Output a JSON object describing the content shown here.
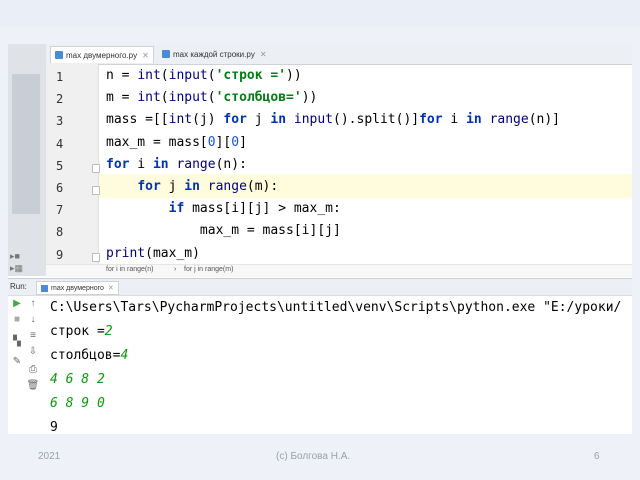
{
  "editor": {
    "tabs": [
      {
        "label": "max двумерного.py",
        "active": true
      },
      {
        "label": "max каждой строки.py",
        "active": false
      }
    ],
    "line_numbers": [
      "1",
      "2",
      "3",
      "4",
      "5",
      "6",
      "7",
      "8",
      "9"
    ],
    "code_lines": [
      [
        {
          "t": "n = ",
          "c": ""
        },
        {
          "t": "int",
          "c": "bi"
        },
        {
          "t": "(",
          "c": ""
        },
        {
          "t": "input",
          "c": "bi"
        },
        {
          "t": "(",
          "c": ""
        },
        {
          "t": "'строк ='",
          "c": "st"
        },
        {
          "t": "))",
          "c": ""
        }
      ],
      [
        {
          "t": "m = ",
          "c": ""
        },
        {
          "t": "int",
          "c": "bi"
        },
        {
          "t": "(",
          "c": ""
        },
        {
          "t": "input",
          "c": "bi"
        },
        {
          "t": "(",
          "c": ""
        },
        {
          "t": "'столбцов='",
          "c": "st"
        },
        {
          "t": "))",
          "c": ""
        }
      ],
      [
        {
          "t": "mass =[[",
          "c": ""
        },
        {
          "t": "int",
          "c": "bi"
        },
        {
          "t": "(j) ",
          "c": ""
        },
        {
          "t": "for",
          "c": "kw"
        },
        {
          "t": " j ",
          "c": ""
        },
        {
          "t": "in",
          "c": "kw"
        },
        {
          "t": " ",
          "c": ""
        },
        {
          "t": "input",
          "c": "bi"
        },
        {
          "t": "().split()]",
          "c": ""
        },
        {
          "t": "for",
          "c": "kw"
        },
        {
          "t": " i ",
          "c": ""
        },
        {
          "t": "in",
          "c": "kw"
        },
        {
          "t": " ",
          "c": ""
        },
        {
          "t": "range",
          "c": "bi"
        },
        {
          "t": "(n)]",
          "c": ""
        }
      ],
      [
        {
          "t": "max_m = mass[",
          "c": ""
        },
        {
          "t": "0",
          "c": "nm"
        },
        {
          "t": "][",
          "c": ""
        },
        {
          "t": "0",
          "c": "nm"
        },
        {
          "t": "]",
          "c": ""
        }
      ],
      [
        {
          "t": "for",
          "c": "kw"
        },
        {
          "t": " i ",
          "c": ""
        },
        {
          "t": "in",
          "c": "kw"
        },
        {
          "t": " ",
          "c": ""
        },
        {
          "t": "range",
          "c": "bi"
        },
        {
          "t": "(n):",
          "c": ""
        }
      ],
      [
        {
          "t": "    ",
          "c": ""
        },
        {
          "t": "for",
          "c": "kw"
        },
        {
          "t": " j ",
          "c": ""
        },
        {
          "t": "in",
          "c": "kw"
        },
        {
          "t": " ",
          "c": ""
        },
        {
          "t": "range",
          "c": "bi"
        },
        {
          "t": "(m):",
          "c": ""
        }
      ],
      [
        {
          "t": "        ",
          "c": ""
        },
        {
          "t": "if",
          "c": "kw"
        },
        {
          "t": " mass[i][j] > max_m:",
          "c": ""
        }
      ],
      [
        {
          "t": "            max_m = mass[i][j]",
          "c": ""
        }
      ],
      [
        {
          "t": "print",
          "c": "bi"
        },
        {
          "t": "(max_m)",
          "c": ""
        }
      ]
    ],
    "breadcrumb": [
      "for i in range(n)",
      "for j in range(m)"
    ]
  },
  "run": {
    "label": "Run:",
    "tab_label": "max двумерного",
    "console_lines": [
      [
        {
          "t": "C:\\Users\\Tars\\PycharmProjects\\untitled\\venv\\Scripts\\python.exe \"E:/уроки/",
          "c": ""
        }
      ],
      [
        {
          "t": "строк =",
          "c": ""
        },
        {
          "t": "2",
          "c": "in"
        }
      ],
      [
        {
          "t": "столбцов=",
          "c": ""
        },
        {
          "t": "4",
          "c": "in"
        }
      ],
      [
        {
          "t": "4 6 8 2",
          "c": "in"
        }
      ],
      [
        {
          "t": "6 8 9 0",
          "c": "in"
        }
      ],
      [
        {
          "t": "9",
          "c": ""
        }
      ]
    ]
  },
  "footer": {
    "year": "2021",
    "author": "(с) Болгова Н.А.",
    "page": "6"
  }
}
